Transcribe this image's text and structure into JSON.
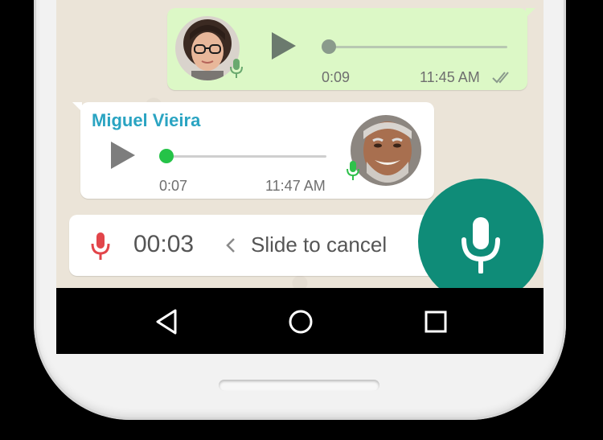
{
  "messages": [
    {
      "direction": "outgoing",
      "duration": "0:09",
      "time": "11:45 AM",
      "status": "read-double-check",
      "avatar": "woman-with-glasses-avatar",
      "mic_color": "#6aa96f"
    },
    {
      "direction": "incoming",
      "sender": "Miguel Vieira",
      "duration": "0:07",
      "time": "11:47 AM",
      "avatar": "smiling-man-avatar",
      "mic_color": "#2fc14b"
    }
  ],
  "recorder": {
    "elapsed": "00:03",
    "hint": "Slide to cancel",
    "mic_color": "#e2454a",
    "record_button_color": "#0f8c78"
  },
  "navigation": {
    "buttons": [
      "back",
      "home",
      "recents"
    ]
  },
  "colors": {
    "outgoing_bubble": "#dcf8c6",
    "incoming_bubble": "#ffffff",
    "accent_green": "#25c348",
    "sender_name": "#2aa4c2"
  }
}
